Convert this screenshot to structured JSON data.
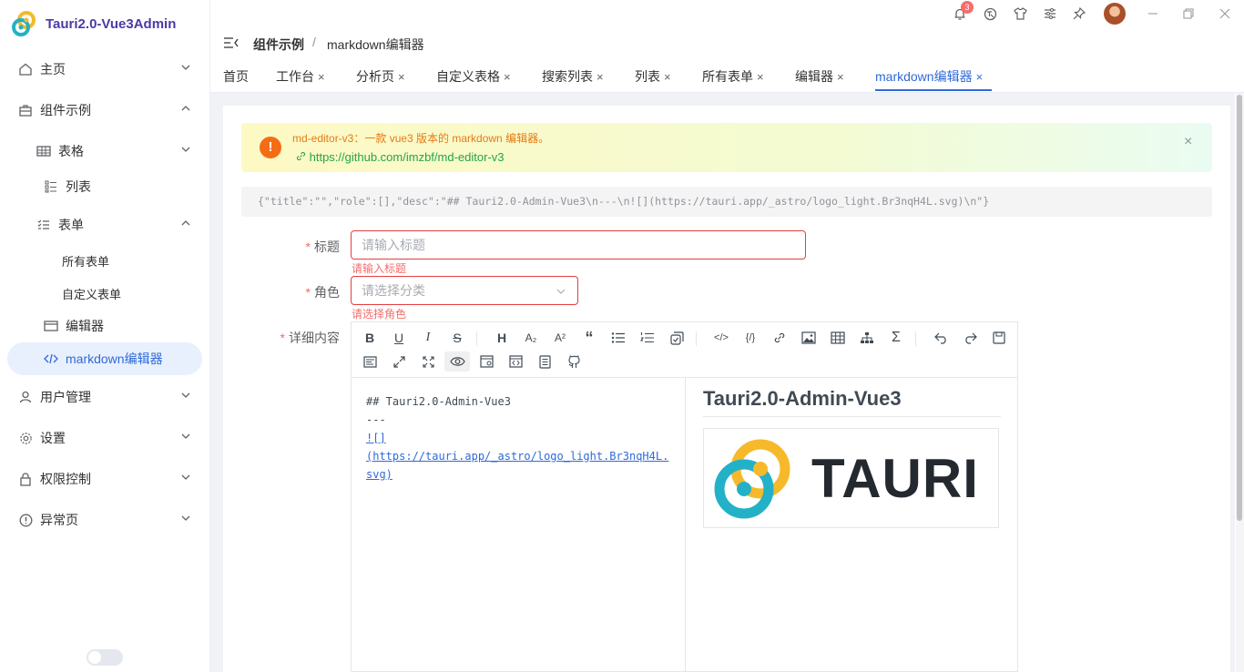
{
  "app": {
    "title": "Tauri2.0-Vue3Admin"
  },
  "sidebar": {
    "items": [
      {
        "label": "主页",
        "icon": "home-icon"
      },
      {
        "label": "组件示例",
        "icon": "briefcase-icon"
      },
      {
        "label": "表格",
        "icon": "table-icon"
      },
      {
        "label": "列表",
        "icon": "list-icon"
      },
      {
        "label": "表单",
        "icon": "form-icon"
      },
      {
        "label": "所有表单",
        "icon": ""
      },
      {
        "label": "自定义表单",
        "icon": ""
      },
      {
        "label": "编辑器",
        "icon": "editor-icon"
      },
      {
        "label": "markdown编辑器",
        "icon": "code-icon"
      },
      {
        "label": "用户管理",
        "icon": "user-icon"
      },
      {
        "label": "设置",
        "icon": "gear-icon"
      },
      {
        "label": "权限控制",
        "icon": "lock-icon"
      },
      {
        "label": "异常页",
        "icon": "warning-icon"
      }
    ]
  },
  "header": {
    "notification_count": "3",
    "breadcrumb": {
      "parent": "组件示例",
      "separator": "/",
      "current": "markdown编辑器"
    }
  },
  "tabs": [
    {
      "label": "首页"
    },
    {
      "label": "工作台"
    },
    {
      "label": "分析页"
    },
    {
      "label": "自定义表格"
    },
    {
      "label": "搜索列表"
    },
    {
      "label": "列表"
    },
    {
      "label": "所有表单"
    },
    {
      "label": "编辑器"
    },
    {
      "label": "markdown编辑器"
    }
  ],
  "tab_close": "×",
  "alert": {
    "icon": "!",
    "title": "md-editor-v3：一款 vue3 版本的 markdown 编辑器。",
    "link": "https://github.com/imzbf/md-editor-v3",
    "close": "×"
  },
  "json_preview": "{\"title\":\"\",\"role\":[],\"desc\":\"## Tauri2.0-Admin-Vue3\\n---\\n![](https://tauri.app/_astro/logo_light.Br3nqH4L.svg)\\n\"}",
  "form": {
    "required_mark": "*",
    "title": {
      "label": "标题",
      "placeholder": "请输入标题",
      "error": "请输入标题"
    },
    "role": {
      "label": "角色",
      "placeholder": "请选择分类",
      "error": "请选择角色"
    },
    "content": {
      "label": "详细内容"
    }
  },
  "editor": {
    "source_lines": [
      "## Tauri2.0-Admin-Vue3",
      "---",
      "![]",
      "(https://tauri.app/_astro/logo_light.Br3nqH4L.svg)"
    ],
    "preview_title": "Tauri2.0-Admin-Vue3",
    "logo_text": "TAURI"
  }
}
